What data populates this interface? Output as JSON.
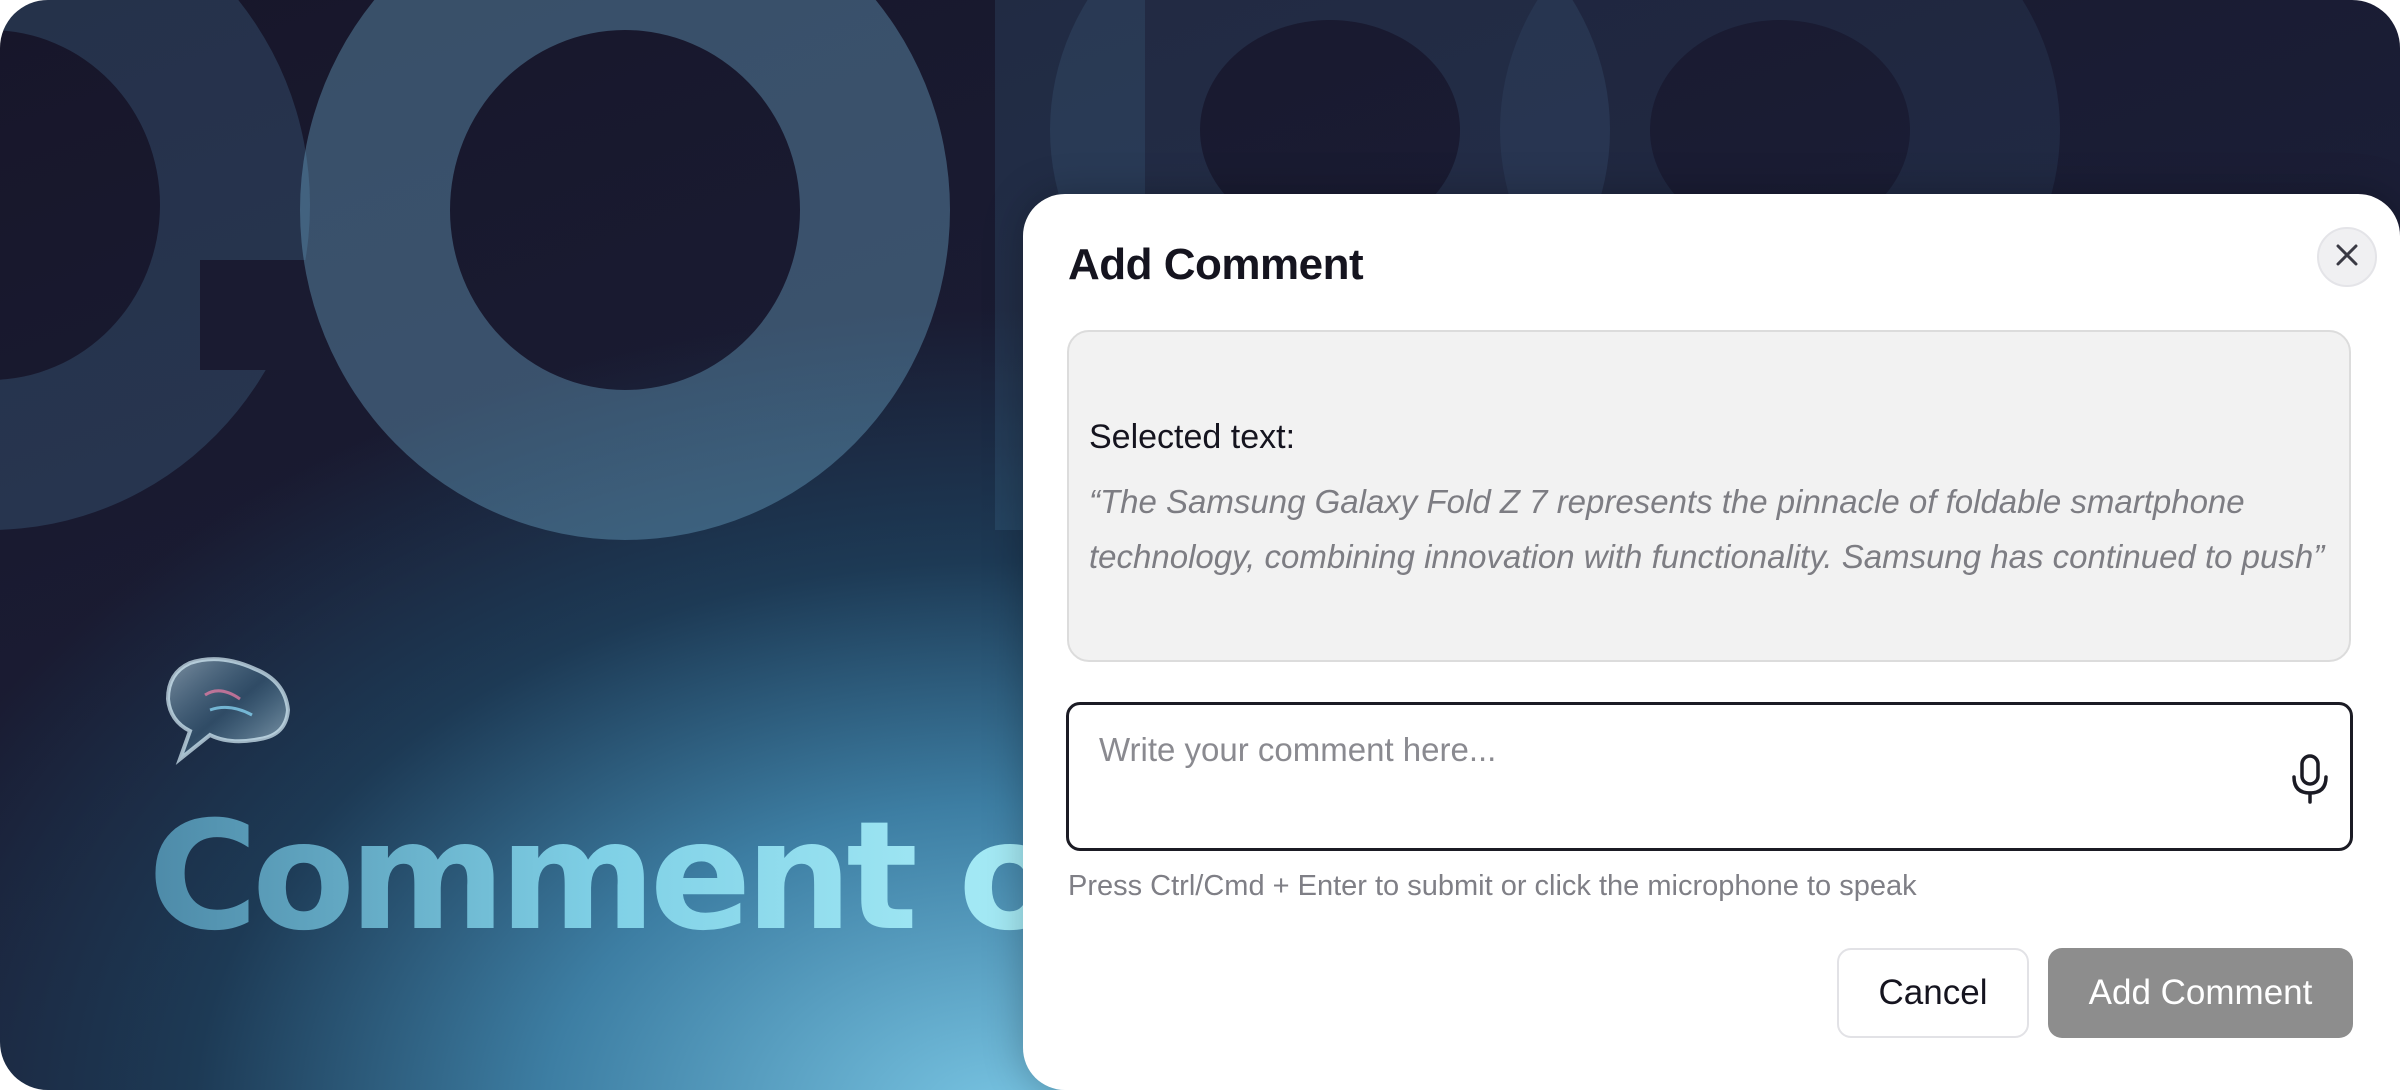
{
  "background": {
    "hero_title": "Comment on",
    "bubble_icon": "speech-bubble-icon"
  },
  "dialog": {
    "title": "Add Comment",
    "close_icon": "close-icon",
    "selected_label": "Selected text:",
    "selected_text": "“The Samsung Galaxy Fold Z 7 represents the pinnacle of foldable smartphone technology, combining innovation with functionality. Samsung has continued to push”",
    "comment_placeholder": "Write your comment here...",
    "mic_icon": "microphone-icon",
    "hint": "Press Ctrl/Cmd + Enter to submit or click the microphone to speak",
    "cancel_label": "Cancel",
    "submit_label": "Add Comment"
  },
  "colors": {
    "submit_button": "#8d8d8d",
    "quote_background": "#f2f2f2",
    "field_border": "#1b1b24"
  }
}
